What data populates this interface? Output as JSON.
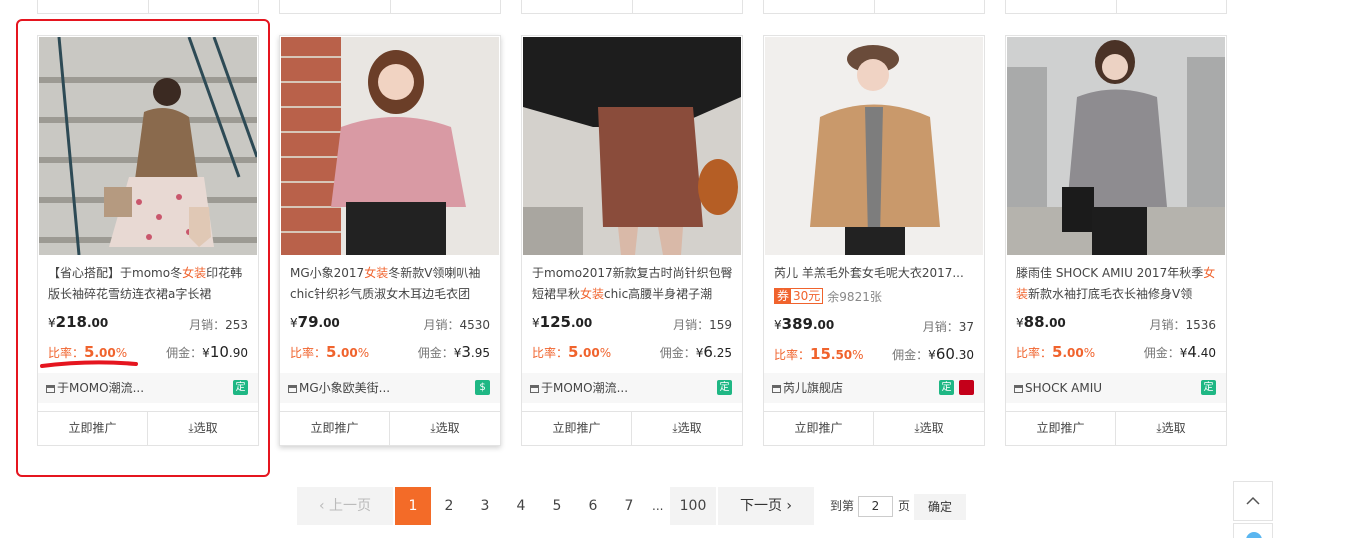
{
  "products": [
    {
      "title_pre": "【省心搭配】于momo冬",
      "title_hl": "女装",
      "title_post": "印花韩版长袖碎花雪纺连衣裙a字长裙",
      "price_int": "218",
      "price_dec": ".00",
      "sales_label": "月销：",
      "sales": "253",
      "rate_label": "比率：",
      "rate_int": "5",
      "rate_dec": ".00",
      "rate_pct": "%",
      "comm_label": "佣金：",
      "comm_yen": "¥",
      "comm_int": "10",
      "comm_dec": ".90",
      "shop": "于MOMO潮流...",
      "badge": "定",
      "action1": "立即推广",
      "action2": "选取"
    },
    {
      "title_pre": "MG小象2017",
      "title_hl": "女装",
      "title_post": "冬新款V领喇叭袖chic针织衫气质淑女木耳边毛衣团",
      "price_int": "79",
      "price_dec": ".00",
      "sales_label": "月销：",
      "sales": "4530",
      "rate_label": "比率：",
      "rate_int": "5",
      "rate_dec": ".00",
      "rate_pct": "%",
      "comm_label": "佣金：",
      "comm_yen": "¥",
      "comm_int": "3",
      "comm_dec": ".95",
      "shop": "MG小象欧美街...",
      "badge": "💰",
      "action1": "立即推广",
      "action2": "选取"
    },
    {
      "title_pre": "于momo2017新款复古时尚针织包臀短裙早秋",
      "title_hl": "女装",
      "title_post": "chic高腰半身裙子潮",
      "price_int": "125",
      "price_dec": ".00",
      "sales_label": "月销：",
      "sales": "159",
      "rate_label": "比率：",
      "rate_int": "5",
      "rate_dec": ".00",
      "rate_pct": "%",
      "comm_label": "佣金：",
      "comm_yen": "¥",
      "comm_int": "6",
      "comm_dec": ".25",
      "shop": "于MOMO潮流...",
      "badge": "定",
      "action1": "立即推广",
      "action2": "选取"
    },
    {
      "title_pre": "芮儿 羊羔毛外套女毛呢大衣2017...",
      "title_hl": "",
      "title_post": "",
      "coupon_q": "券",
      "coupon_v": "30元",
      "remain": "余9821张",
      "price_int": "389",
      "price_dec": ".00",
      "sales_label": "月销：",
      "sales": "37",
      "rate_label": "比率：",
      "rate_int": "15",
      "rate_dec": ".50",
      "rate_pct": "%",
      "comm_label": "佣金：",
      "comm_yen": "¥",
      "comm_int": "60",
      "comm_dec": ".30",
      "shop": "芮儿旗舰店",
      "badge": "定",
      "action1": "立即推广",
      "action2": "选取"
    },
    {
      "title_pre": "滕雨佳 SHOCK AMIU 2017年秋季",
      "title_hl": "女装",
      "title_post": "新款水袖打底毛衣长袖修身V领",
      "price_int": "88",
      "price_dec": ".00",
      "sales_label": "月销：",
      "sales": "1536",
      "rate_label": "比率：",
      "rate_int": "5",
      "rate_dec": ".00",
      "rate_pct": "%",
      "comm_label": "佣金：",
      "comm_yen": "¥",
      "comm_int": "4",
      "comm_dec": ".40",
      "shop": "SHOCK AMIU",
      "badge": "定",
      "action1": "立即推广",
      "action2": "选取"
    }
  ],
  "currency": "¥",
  "pagination": {
    "prev": "上一页",
    "pages": [
      "1",
      "2",
      "3",
      "4",
      "5",
      "6",
      "7"
    ],
    "ellipsis": "...",
    "last": "100",
    "next": "下一页",
    "goto_label": "到第",
    "goto_value": "2",
    "page_unit": "页",
    "confirm": "确定"
  },
  "colors": {
    "accent": "#f36b28",
    "highlight": "#e5151f",
    "badge": "#1fb784"
  }
}
